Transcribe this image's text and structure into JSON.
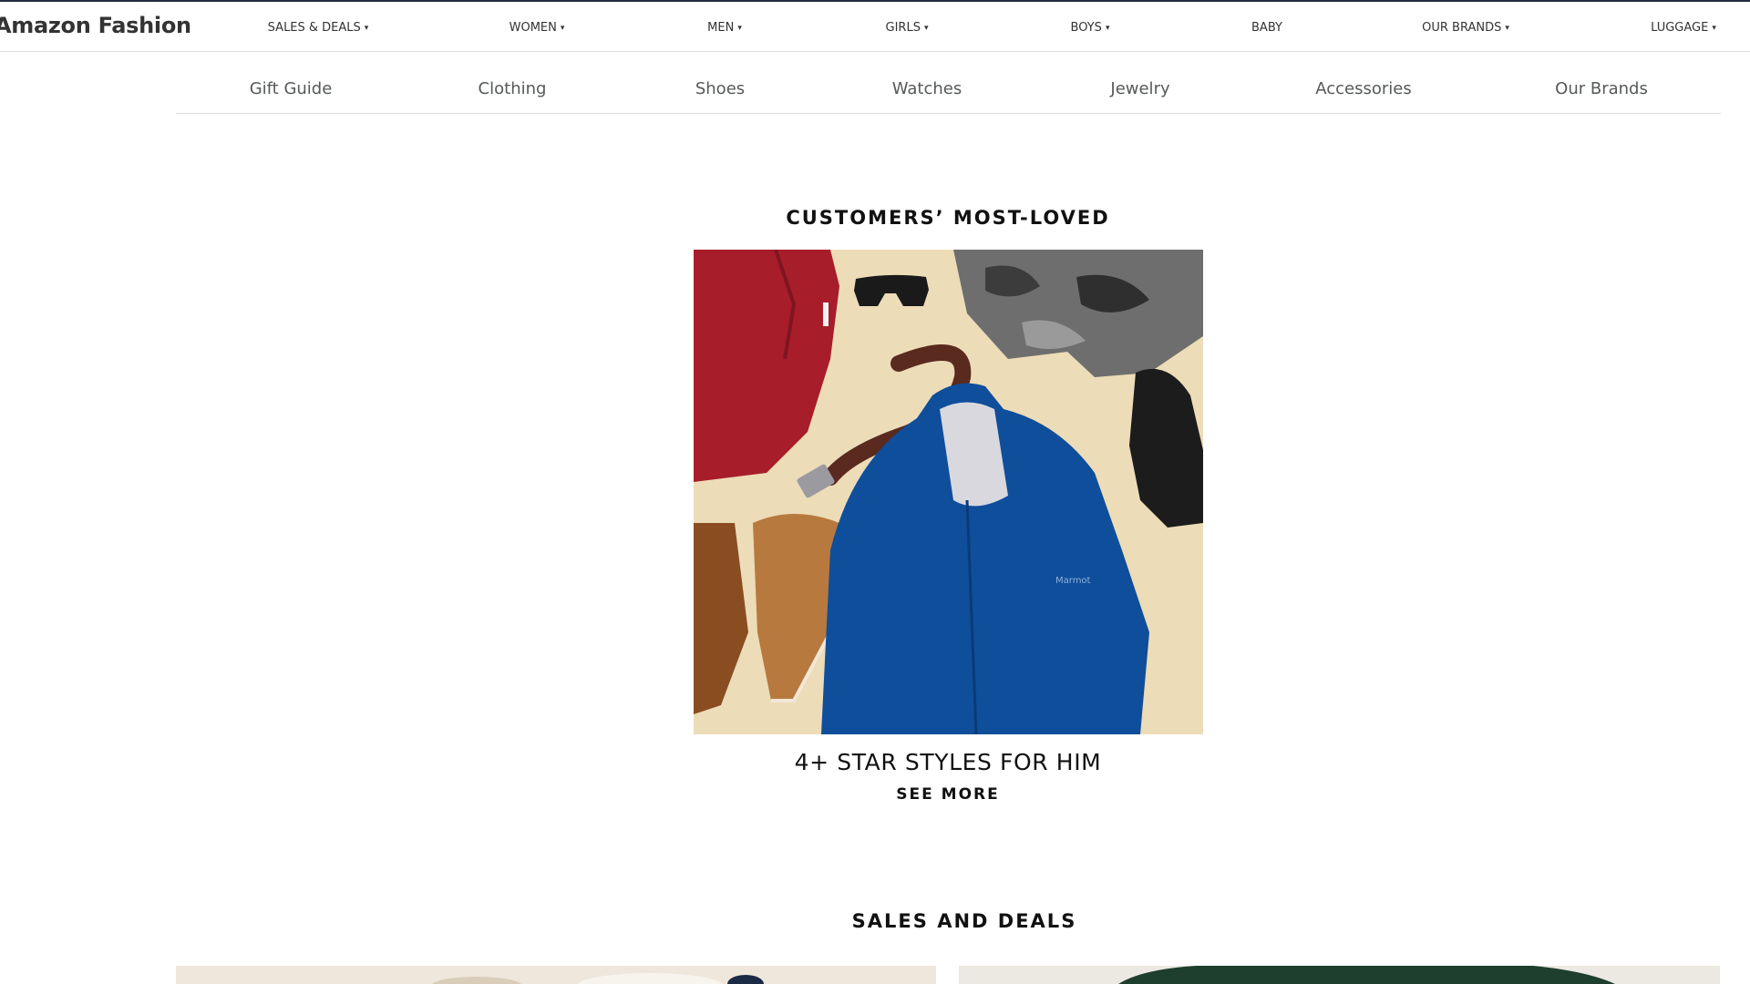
{
  "header": {
    "brand": "Amazon Fashion",
    "nav": [
      {
        "label": "SALES & DEALS",
        "dropdown": true
      },
      {
        "label": "WOMEN",
        "dropdown": true
      },
      {
        "label": "MEN",
        "dropdown": true
      },
      {
        "label": "GIRLS",
        "dropdown": true
      },
      {
        "label": "BOYS",
        "dropdown": true
      },
      {
        "label": "BABY",
        "dropdown": false
      },
      {
        "label": "OUR BRANDS",
        "dropdown": true
      },
      {
        "label": "LUGGAGE",
        "dropdown": true
      }
    ],
    "caret_glyph": "▾"
  },
  "subnav": [
    "Gift Guide",
    "Clothing",
    "Shoes",
    "Watches",
    "Jewelry",
    "Accessories",
    "Our Brands"
  ],
  "featured": {
    "title": "CUSTOMERS’ MOST-LOVED",
    "caption": "4+ STAR STYLES FOR HIM",
    "cta": "SEE MORE",
    "image_subject": "Flat lay of men's apparel: red shirt, sunglasses, camo shorts, brown belt, blue hooded rain jacket, black leather gloves, tan suede boots",
    "image_bg": "#ecdcb8",
    "jacket_text": "Marmot"
  },
  "deals": {
    "title": "SALES AND DEALS",
    "tiles": [
      {
        "subject": "sherpa fleece jacket",
        "bg": "#efe7db"
      },
      {
        "subject": "green outerwear",
        "bg": "#ece9e3"
      }
    ]
  }
}
